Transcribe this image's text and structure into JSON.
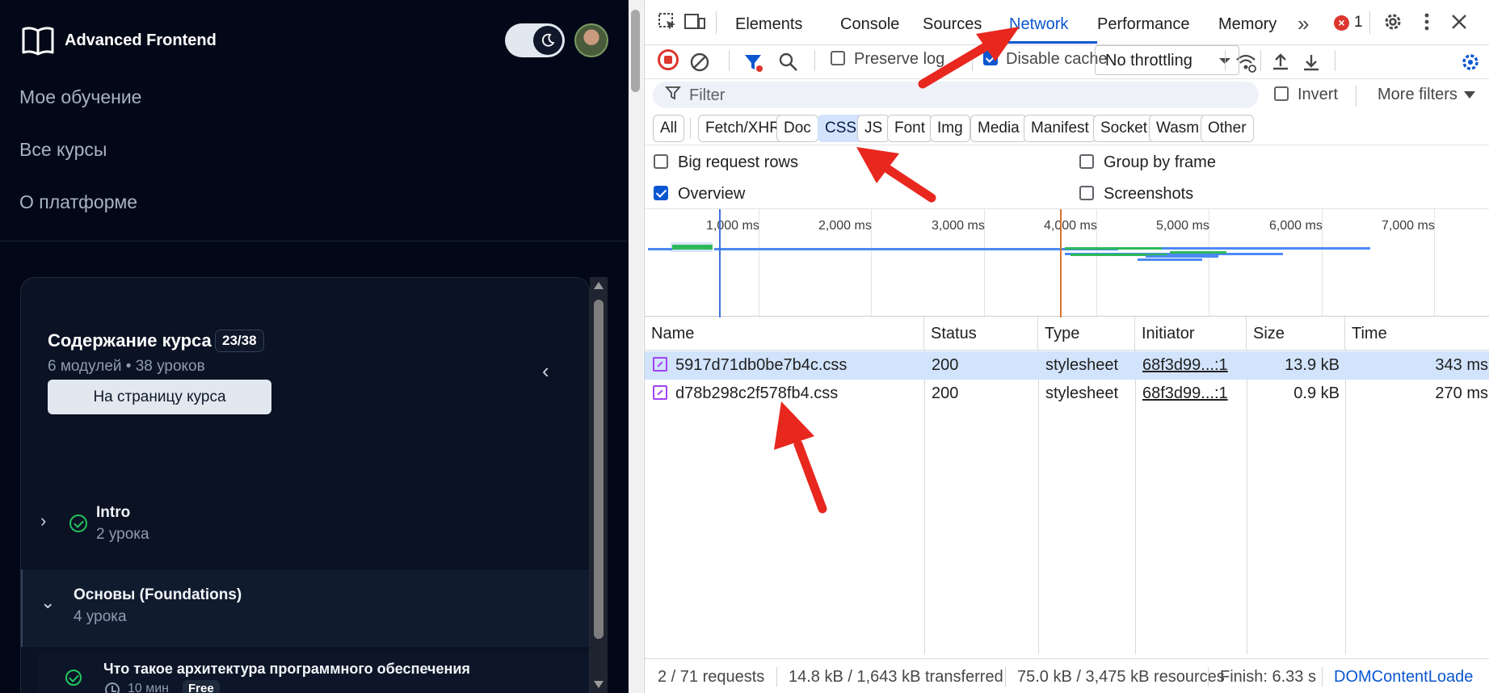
{
  "site": {
    "brand": "Advanced Frontend",
    "nav": [
      "Мое обучение",
      "Все курсы",
      "О платформе"
    ],
    "course": {
      "title": "Содержание курса",
      "progress": "23/38",
      "meta": "6 модулей • 38 уроков",
      "button": "На страницу курса",
      "collapse_glyph": "‹",
      "modules": [
        {
          "title": "Intro",
          "subtitle": "2 урока",
          "chevron": "›"
        },
        {
          "title": "Основы (Foundations)",
          "subtitle": "4 урока",
          "chevron": "⌄"
        }
      ],
      "lesson": {
        "title": "Что такое архитектура программного обеспечения",
        "duration": "10 мин",
        "badge": "Free"
      }
    }
  },
  "devtools": {
    "tabs": [
      "Elements",
      "Console",
      "Sources",
      "Network",
      "Performance",
      "Memory"
    ],
    "active_tab": "Network",
    "more_tabs": "»",
    "error_count": "1",
    "toolbar": {
      "preserve_log": "Preserve log",
      "disable_cache": "Disable cache",
      "throttling": "No throttling"
    },
    "filter": {
      "placeholder": "Filter",
      "invert": "Invert",
      "more_filters": "More filters"
    },
    "type_filters": [
      "All",
      "Fetch/XHR",
      "Doc",
      "CSS",
      "JS",
      "Font",
      "Img",
      "Media",
      "Manifest",
      "Socket",
      "Wasm",
      "Other"
    ],
    "active_type_filter": "CSS",
    "options": {
      "big_request_rows": "Big request rows",
      "group_by_frame": "Group by frame",
      "overview": "Overview",
      "screenshots": "Screenshots"
    },
    "overview_ticks": [
      "1,000 ms",
      "2,000 ms",
      "3,000 ms",
      "4,000 ms",
      "5,000 ms",
      "6,000 ms",
      "7,000 ms"
    ],
    "columns": [
      "Name",
      "Status",
      "Type",
      "Initiator",
      "Size",
      "Time"
    ],
    "requests": [
      {
        "name": "5917d71db0be7b4c.css",
        "status": "200",
        "type": "stylesheet",
        "initiator": "68f3d99...:1",
        "size": "13.9 kB",
        "time": "343 ms"
      },
      {
        "name": "d78b298c2f578fb4.css",
        "status": "200",
        "type": "stylesheet",
        "initiator": "68f3d99...:1",
        "size": "0.9 kB",
        "time": "270 ms"
      }
    ],
    "status_bar": {
      "requests": "2 / 71 requests",
      "transferred": "14.8 kB / 1,643 kB transferred",
      "resources": "75.0 kB / 3,475 kB resources",
      "finish": "Finish: 6.33 s",
      "dcl": "DOMContentLoade"
    }
  },
  "colors": {
    "site_bg": "#020817",
    "devtools_accent": "#0b57d0",
    "annotation_arrow": "#e8271f",
    "success": "#22c55e"
  }
}
